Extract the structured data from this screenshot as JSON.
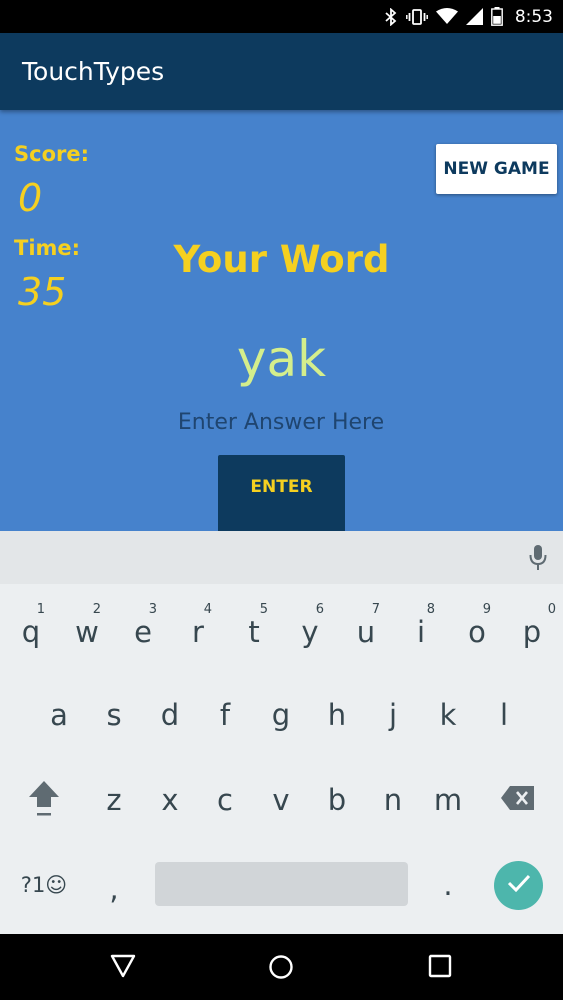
{
  "status_bar": {
    "time": "8:53",
    "icons": [
      "bluetooth-icon",
      "vibrate-icon",
      "wifi-icon",
      "signal-icon",
      "battery-icon"
    ]
  },
  "app_bar": {
    "title": "TouchTypes"
  },
  "game": {
    "score_label": "Score:",
    "score_value": "0",
    "time_label": "Time:",
    "time_value": "35",
    "new_game_label": "NEW GAME",
    "your_word_label": "Your Word",
    "word": "yak",
    "answer_placeholder": "Enter Answer Here",
    "answer_value": "",
    "enter_label": "ENTER"
  },
  "keyboard": {
    "row1": [
      {
        "key": "q",
        "hint": "1"
      },
      {
        "key": "w",
        "hint": "2"
      },
      {
        "key": "e",
        "hint": "3"
      },
      {
        "key": "r",
        "hint": "4"
      },
      {
        "key": "t",
        "hint": "5"
      },
      {
        "key": "y",
        "hint": "6"
      },
      {
        "key": "u",
        "hint": "7"
      },
      {
        "key": "i",
        "hint": "8"
      },
      {
        "key": "o",
        "hint": "9"
      },
      {
        "key": "p",
        "hint": "0"
      }
    ],
    "row2": [
      "a",
      "s",
      "d",
      "f",
      "g",
      "h",
      "j",
      "k",
      "l"
    ],
    "row3": [
      "z",
      "x",
      "c",
      "v",
      "b",
      "n",
      "m"
    ],
    "symbols_label": "?1☺",
    "comma": ",",
    "period": ".",
    "icons": [
      "mic-icon",
      "shift-icon",
      "backspace-icon",
      "checkmark-icon"
    ]
  },
  "nav_bar": {
    "icons": [
      "back-icon",
      "home-icon",
      "recents-icon"
    ]
  },
  "colors": {
    "app_bar": "#0d3a5e",
    "content_bg": "#4682cc",
    "accent_yellow": "#f5d020",
    "word_green": "#d4ee8c",
    "keyboard_bg": "#eceff1",
    "enter_key": "#4db6ac"
  }
}
